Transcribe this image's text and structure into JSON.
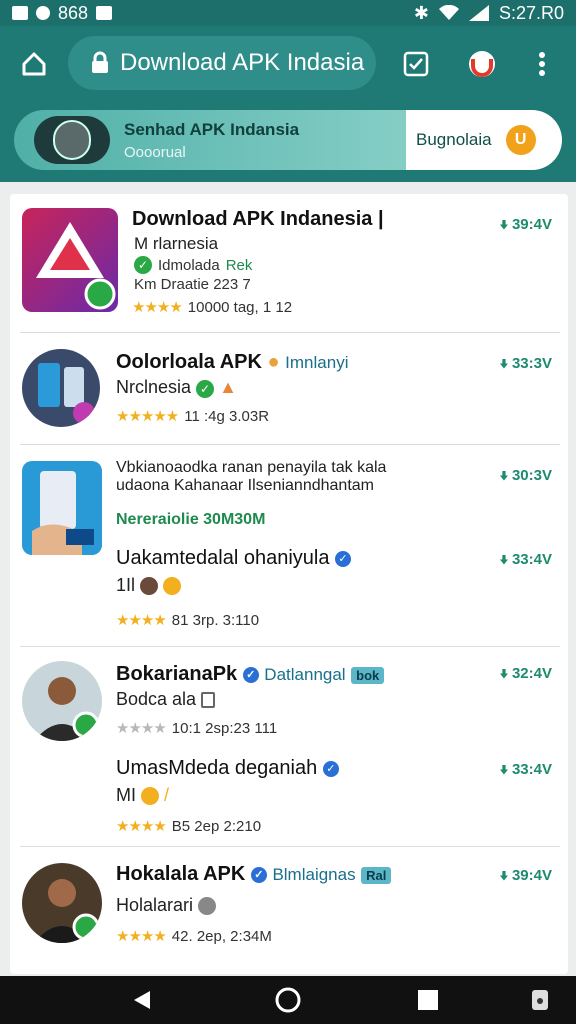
{
  "status_bar": {
    "time": "S:27.R0",
    "left_text": "868"
  },
  "toolbar": {
    "url_title": "Download APK Indasia"
  },
  "banner": {
    "title": "Senhad APK Indansia",
    "subtitle": "Oooorual",
    "right_label": "Bugnolaia",
    "right_badge": "U"
  },
  "items": [
    {
      "title": "Download APK Indanesia |",
      "line2": "M rlarnesia",
      "line3": "Idmolada",
      "line3_tag": "Rek",
      "line4": "Km Draatie 223 7",
      "rating_text": "10000 tag, 1 12",
      "size": "39:4V"
    },
    {
      "title": "Oolorloala APK",
      "title_suffix": "Imnlanyi",
      "line2": "Nrclnesia",
      "rating_text": "11 :4g 3.03R",
      "size": "33:3V"
    },
    {
      "title": "Vbkianoaodka ranan penayila tak kala",
      "line2": "udaona Kahanaar Ilsenianndhantam",
      "line3": "Nereraiolie 30M30M",
      "size": "30:3V"
    },
    {
      "title": "Uakamtedalal ohaniyula",
      "line2": "1Il",
      "rating_text": "81  3rp. 3:110",
      "size": "33:4V"
    },
    {
      "title": "BokarianaPk",
      "title_suffix": "Datlanngal",
      "title_tag": "bok",
      "line2": "Bodca ala",
      "rating_text": "10:1 2sp:23 111",
      "size": "32:4V"
    },
    {
      "title": "UmasMdeda deganiah",
      "line2": "MI",
      "rating_text": "B5  2ep 2:210",
      "size": "33:4V"
    },
    {
      "title": "Hokalala APK",
      "title_suffix": "Blmlaignas",
      "title_tag": "Ral",
      "line2": "Holalarari",
      "rating_text": "42. 2ep, 2:34M",
      "size": "39:4V"
    }
  ]
}
